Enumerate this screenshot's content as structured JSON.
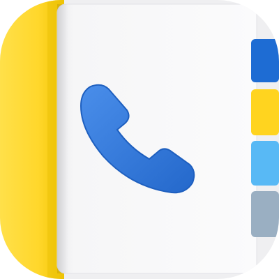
{
  "icon": {
    "semantic": "contacts-phone-book-app-icon",
    "glyph": "phone-handset-icon"
  },
  "colors": {
    "cover_yellow": "#FFD72B",
    "cover_yellow_dark": "#F2C300",
    "page_white": "#F6F6F7",
    "handset_blue": "#2F78D9",
    "tab_blue": "#1E6CD3",
    "tab_yellow": "#FFD41F",
    "tab_light_blue": "#58B9F5",
    "tab_gray": "#9AAFC2"
  },
  "tabs": [
    {
      "name": "tab-blue",
      "color": "#1E6CD3"
    },
    {
      "name": "tab-yellow",
      "color": "#FFD41F"
    },
    {
      "name": "tab-light-blue",
      "color": "#58B9F5"
    },
    {
      "name": "tab-gray",
      "color": "#9AAFC2"
    }
  ]
}
